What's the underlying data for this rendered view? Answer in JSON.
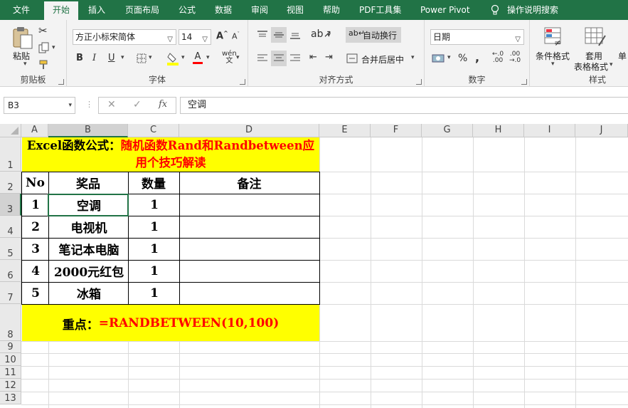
{
  "menu": {
    "tabs": [
      "文件",
      "开始",
      "插入",
      "页面布局",
      "公式",
      "数据",
      "审阅",
      "视图",
      "帮助",
      "PDF工具集",
      "Power Pivot",
      "操作说明搜索"
    ]
  },
  "ribbon": {
    "clipboard": {
      "paste": "粘贴",
      "label": "剪贴板"
    },
    "font": {
      "name": "方正小标宋简体",
      "size": "14",
      "grow": "A",
      "shrink": "A",
      "bold": "B",
      "italic": "I",
      "underline": "U",
      "phonetic": "wén",
      "label": "字体"
    },
    "align": {
      "wrap": "自动换行",
      "merge": "合并后居中",
      "label": "对齐方式"
    },
    "number": {
      "format": "日期",
      "percent": "%",
      "comma": ",",
      "label": "数字"
    },
    "styles": {
      "cond": "条件格式",
      "table1": "套用",
      "table2": "表格格式",
      "cell": "单",
      "label": "样式"
    }
  },
  "formula_bar": {
    "name_box": "B3",
    "fx": "fx",
    "content": "空调"
  },
  "columns": [
    "A",
    "B",
    "C",
    "D",
    "E",
    "F",
    "G",
    "H",
    "I",
    "J"
  ],
  "rows": [
    "1",
    "2",
    "3",
    "4",
    "5",
    "6",
    "7",
    "8",
    "9",
    "10",
    "11",
    "12",
    "13"
  ],
  "sheet": {
    "title_black": "Excel函数公式：",
    "title_red1": "随机函数Rand和Randbetween应",
    "title_red2": "用个技巧解读",
    "headers": [
      "No",
      "奖品",
      "数量",
      "备注"
    ],
    "data": [
      [
        "1",
        "空调",
        "1",
        ""
      ],
      [
        "2",
        "电视机",
        "1",
        ""
      ],
      [
        "3",
        "笔记本电脑",
        "1",
        ""
      ],
      [
        "4",
        "2000元红包",
        "1",
        ""
      ],
      [
        "5",
        "冰箱",
        "1",
        ""
      ]
    ],
    "note_black": "重点：",
    "note_red": "=RANDBETWEEN(10,100)"
  },
  "colors": {
    "excel_green": "#217346",
    "highlight": "#ffff00",
    "red": "#ff0000"
  }
}
